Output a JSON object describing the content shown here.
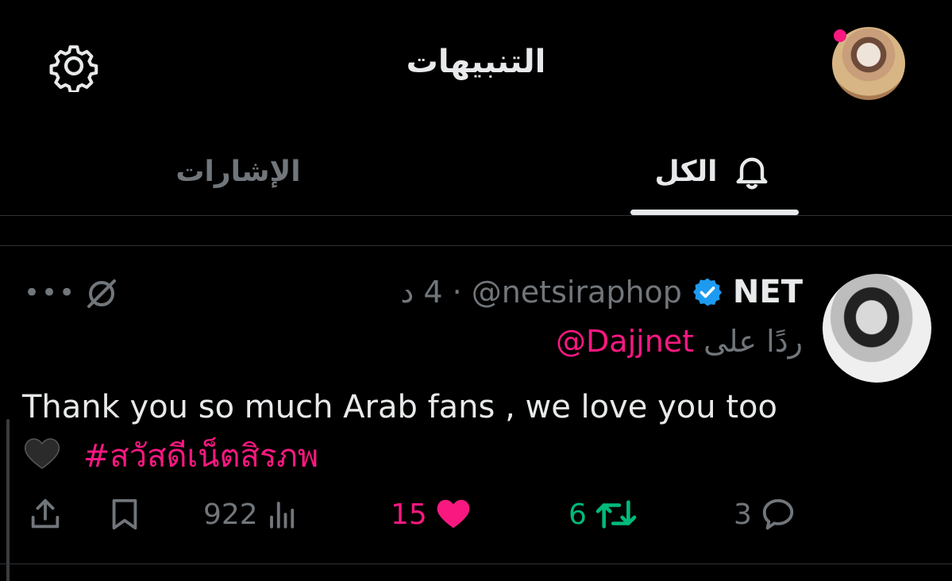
{
  "header": {
    "title": "التنبيهات",
    "settings_icon": "gear-icon",
    "avatar_badge_color": "#f91880"
  },
  "tabs": [
    {
      "label": "الكل",
      "icon": "bell-icon",
      "selected": true
    },
    {
      "label": "الإشارات",
      "selected": false
    }
  ],
  "tweet": {
    "display_name": "NET",
    "verified": true,
    "handle": "@netsiraphop",
    "separator": "·",
    "time": "4 د",
    "reply_prefix": "ردًا على",
    "reply_to": "@Dajjnet",
    "text_line1": "Thank you so much Arab fans , we love you too",
    "emoji": "🖤",
    "hashtag": "#สวัสดีเน็ตสิรภพ",
    "metrics": {
      "views": "922",
      "likes": "15",
      "liked": true,
      "retweets": "6",
      "retweeted": true,
      "replies": "3"
    }
  },
  "colors": {
    "background": "#000000",
    "text": "#e7e9ea",
    "secondary": "#71767b",
    "like": "#f91880",
    "retweet": "#00ba7c",
    "verified": "#1d9bf0"
  }
}
